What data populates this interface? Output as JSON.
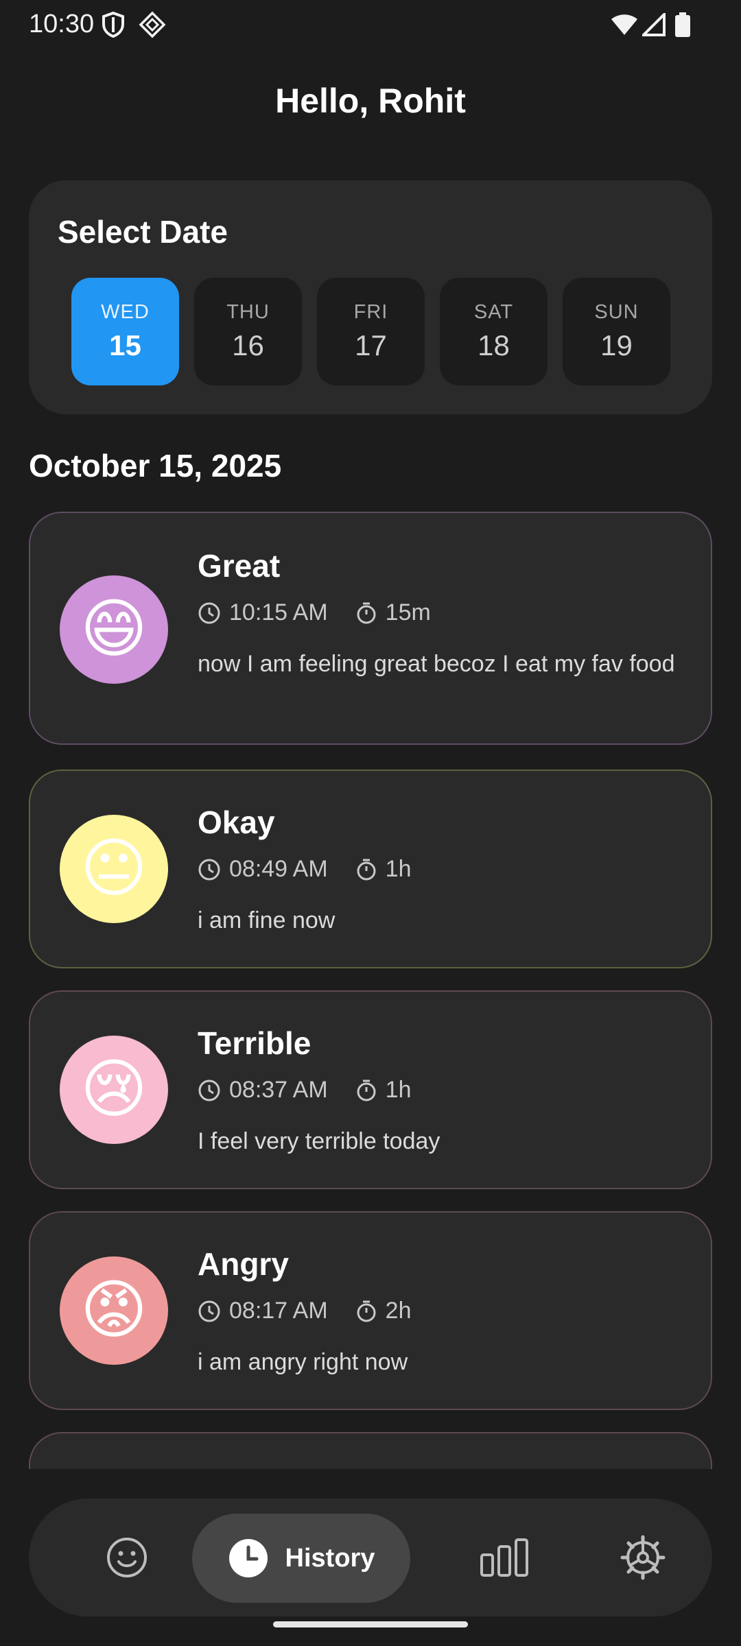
{
  "status_bar": {
    "time": "10:30",
    "icons": [
      "shield-icon",
      "vpn-diamond-icon",
      "wifi-icon",
      "cell-signal-icon",
      "battery-icon"
    ]
  },
  "header": {
    "greeting": "Hello, Rohit"
  },
  "date_picker": {
    "title": "Select Date",
    "days": [
      {
        "name": "WED",
        "num": "15",
        "selected": true
      },
      {
        "name": "THU",
        "num": "16",
        "selected": false
      },
      {
        "name": "FRI",
        "num": "17",
        "selected": false
      },
      {
        "name": "SAT",
        "num": "18",
        "selected": false
      },
      {
        "name": "SUN",
        "num": "19",
        "selected": false
      }
    ]
  },
  "section": {
    "date": "October 15, 2025"
  },
  "moods": [
    {
      "title": "Great",
      "emoji": "😄",
      "time": "10:15 AM",
      "duration": "15m",
      "note": "now I am feeling great becoz I eat my fav food",
      "avatar_color": "#ce93d8",
      "border_color": "#5e4c64"
    },
    {
      "title": "Okay",
      "emoji": "😐",
      "time": "08:49 AM",
      "duration": "1h",
      "note": "i am fine now",
      "avatar_color": "#fff59d",
      "border_color": "#5f6140"
    },
    {
      "title": "Terrible",
      "emoji": "😢",
      "time": "08:37 AM",
      "duration": "1h",
      "note": "I feel very terrible today",
      "avatar_color": "#f8bbd0",
      "border_color": "#5e4a52"
    },
    {
      "title": "Angry",
      "emoji": "😡",
      "time": "08:17 AM",
      "duration": "2h",
      "note": "i am angry right now",
      "avatar_color": "#ef9a9a",
      "border_color": "#5e4a4c"
    }
  ],
  "bottom_nav": {
    "items": [
      {
        "icon": "smiley-icon",
        "label": ""
      },
      {
        "icon": "clock-icon",
        "label": "History",
        "active": true
      },
      {
        "icon": "bar-chart-icon",
        "label": ""
      },
      {
        "icon": "settings-gear-icon",
        "label": ""
      }
    ]
  },
  "colors": {
    "background": "#1c1c1c",
    "card": "#2a2a2a",
    "accent": "#2196f3"
  }
}
